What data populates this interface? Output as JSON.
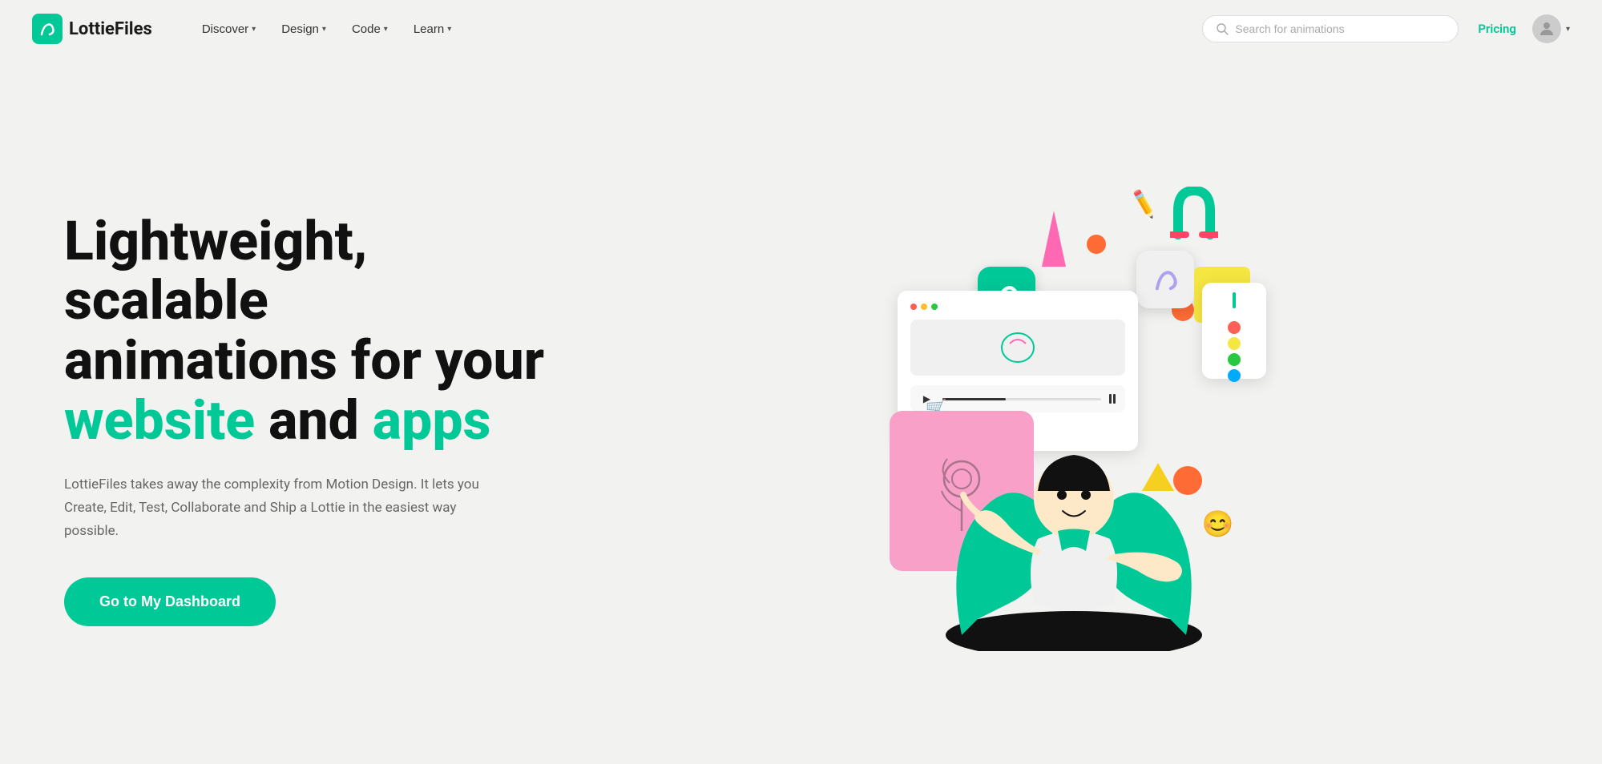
{
  "brand": {
    "name": "LottieFiles",
    "logo_alt": "LottieFiles logo"
  },
  "nav": {
    "links": [
      {
        "label": "Discover",
        "has_dropdown": true
      },
      {
        "label": "Design",
        "has_dropdown": true
      },
      {
        "label": "Code",
        "has_dropdown": true
      },
      {
        "label": "Learn",
        "has_dropdown": true
      }
    ],
    "search_placeholder": "Search for animations",
    "pricing_label": "Pricing"
  },
  "hero": {
    "heading_line1": "Lightweight, scalable",
    "heading_line2": "animations for your",
    "heading_highlight1": "website",
    "heading_and": " and ",
    "heading_highlight2": "apps",
    "description": "LottieFiles takes away the complexity from Motion Design. It lets you Create, Edit, Test, Collaborate and Ship a Lottie in the easiest way possible.",
    "cta_label": "Go to My Dashboard"
  }
}
